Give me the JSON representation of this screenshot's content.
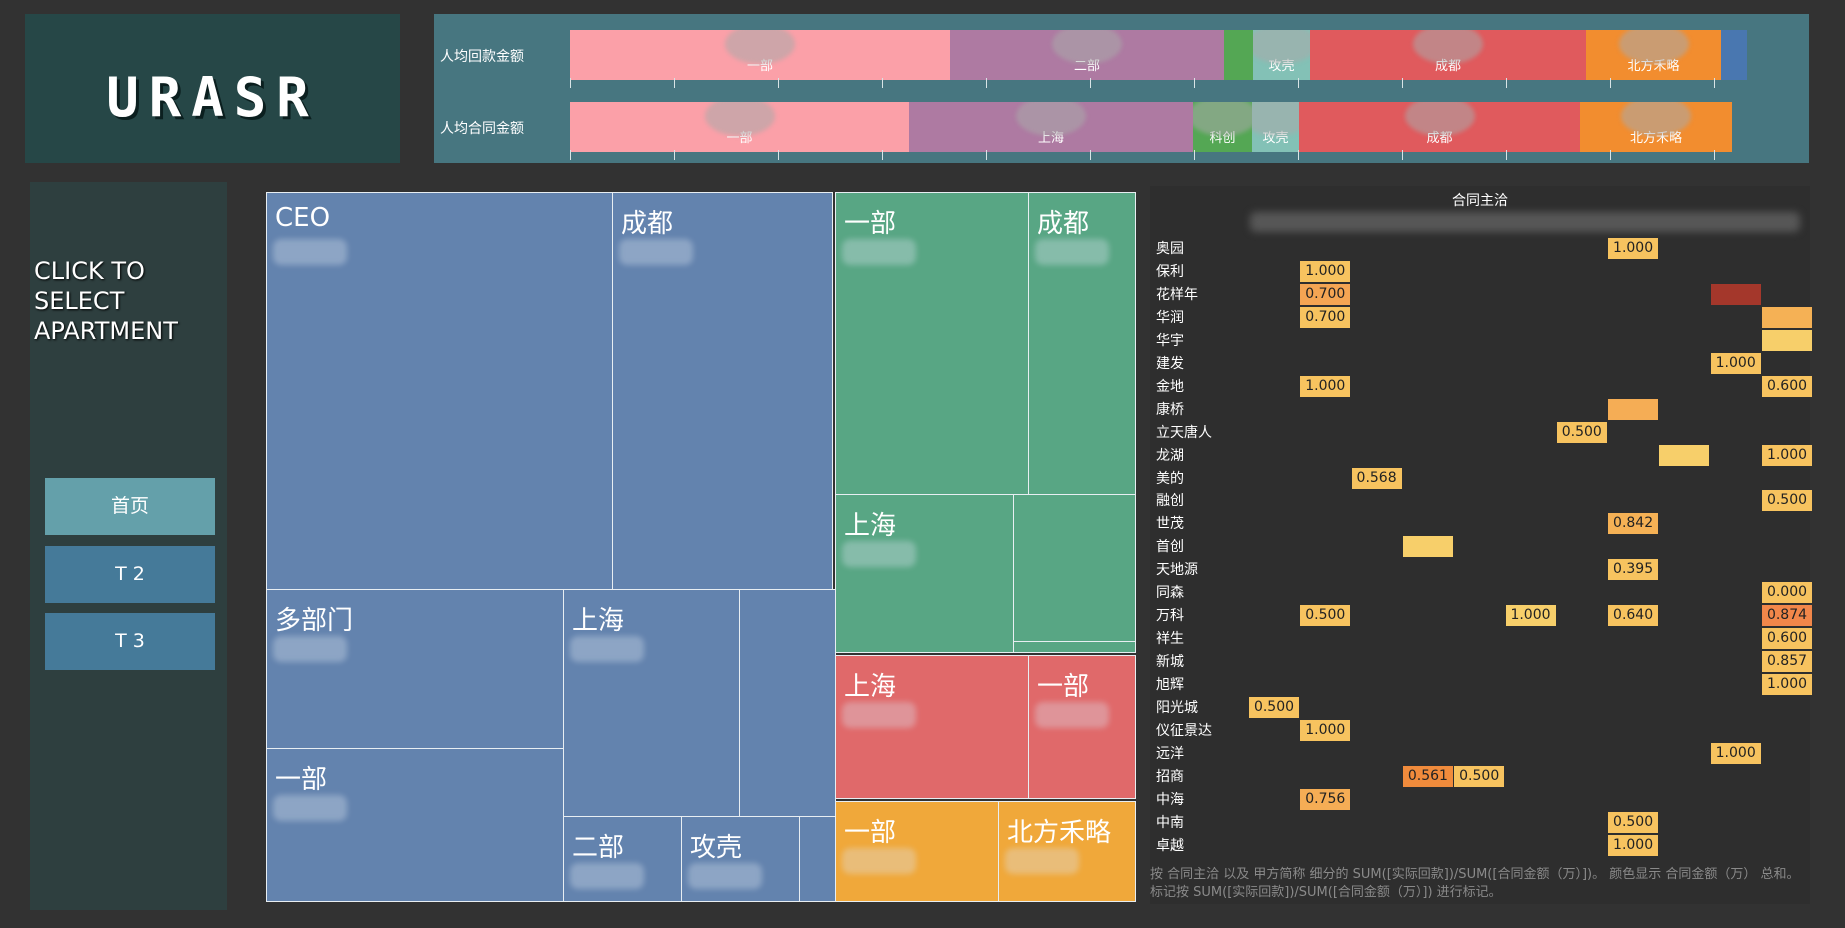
{
  "logo": {
    "text": "URASR"
  },
  "top_bars": [
    {
      "label": "人均回款金额",
      "segments": [
        {
          "label": "一部",
          "share": 0.323,
          "color": "#fba0a8"
        },
        {
          "label": "二部",
          "share": 0.233,
          "color": "#ae7aa2"
        },
        {
          "label": "",
          "share": 0.025,
          "color": "#54a754"
        },
        {
          "label": "攻壳",
          "share": 0.048,
          "color": "#83c1b6"
        },
        {
          "label": "成都",
          "share": 0.234,
          "color": "#e05a5d"
        },
        {
          "label": "北方禾略",
          "share": 0.115,
          "color": "#f28d2f"
        },
        {
          "label": "",
          "share": 0.022,
          "color": "#4977b0"
        }
      ]
    },
    {
      "label": "人均合同金额",
      "segments": [
        {
          "label": "一部",
          "share": 0.29,
          "color": "#fba0a8"
        },
        {
          "label": "上海",
          "share": 0.243,
          "color": "#ae7aa2"
        },
        {
          "label": "科创",
          "share": 0.05,
          "color": "#54a754"
        },
        {
          "label": "攻壳",
          "share": 0.04,
          "color": "#83c1b6"
        },
        {
          "label": "成都",
          "share": 0.24,
          "color": "#e05a5d"
        },
        {
          "label": "北方禾略",
          "share": 0.13,
          "color": "#f28d2f"
        }
      ]
    }
  ],
  "nav": {
    "title": "CLICK TO SELECT APARTMENT",
    "buttons": [
      "首页",
      "T 2",
      "T 3"
    ]
  },
  "treemap": [
    {
      "label": "CEO",
      "color": "blue"
    },
    {
      "label": "成都",
      "color": "blue"
    },
    {
      "label": "多部门",
      "color": "blue"
    },
    {
      "label": "上海",
      "color": "blue"
    },
    {
      "label": "",
      "color": "blue"
    },
    {
      "label": "一部",
      "color": "blue"
    },
    {
      "label": "二部",
      "color": "blue"
    },
    {
      "label": "攻壳",
      "color": "blue"
    },
    {
      "label": "",
      "color": "blue"
    },
    {
      "label": "一部",
      "color": "green"
    },
    {
      "label": "成都",
      "color": "green"
    },
    {
      "label": "上海",
      "color": "green"
    },
    {
      "label": "",
      "color": "green"
    },
    {
      "label": "",
      "color": "green"
    },
    {
      "label": "上海",
      "color": "red"
    },
    {
      "label": "一部",
      "color": "red"
    },
    {
      "label": "一部",
      "color": "orange"
    },
    {
      "label": "北方禾略",
      "color": "orange"
    }
  ],
  "heatmap": {
    "title": "合同主洽",
    "rows": [
      "奥园",
      "保利",
      "花样年",
      "华润",
      "华宇",
      "建发",
      "金地",
      "康桥",
      "立天唐人",
      "龙湖",
      "美的",
      "融创",
      "世茂",
      "首创",
      "天地源",
      "同森",
      "万科",
      "祥生",
      "新城",
      "旭辉",
      "阳光城",
      "仪征景达",
      "远洋",
      "招商",
      "中海",
      "中南",
      "卓越"
    ],
    "cells": [
      {
        "row": 0,
        "col": 7,
        "text": "1.000",
        "color": "#f7c35f"
      },
      {
        "row": 1,
        "col": 1,
        "text": "1.000",
        "color": "#f7c35f"
      },
      {
        "row": 2,
        "col": 1,
        "text": "0.700",
        "color": "#f4a553"
      },
      {
        "row": 2,
        "col": 9,
        "text": "",
        "color": "#a4372b"
      },
      {
        "row": 3,
        "col": 1,
        "text": "0.700",
        "color": "#f7c35f"
      },
      {
        "row": 3,
        "col": 10,
        "text": "",
        "color": "#f5b155"
      },
      {
        "row": 4,
        "col": 10,
        "text": "",
        "color": "#f7cf6a"
      },
      {
        "row": 5,
        "col": 9,
        "text": "1.000",
        "color": "#f7c35f"
      },
      {
        "row": 6,
        "col": 1,
        "text": "1.000",
        "color": "#f7c35f"
      },
      {
        "row": 6,
        "col": 10,
        "text": "0.600",
        "color": "#f7c35f"
      },
      {
        "row": 7,
        "col": 7,
        "text": "",
        "color": "#f5ad55"
      },
      {
        "row": 8,
        "col": 6,
        "text": "0.500",
        "color": "#f7c35f"
      },
      {
        "row": 9,
        "col": 8,
        "text": "",
        "color": "#f7cf6a"
      },
      {
        "row": 9,
        "col": 10,
        "text": "1.000",
        "color": "#f7c35f"
      },
      {
        "row": 10,
        "col": 2,
        "text": "0.568",
        "color": "#f7c35f"
      },
      {
        "row": 11,
        "col": 10,
        "text": "0.500",
        "color": "#f7c35f"
      },
      {
        "row": 12,
        "col": 7,
        "text": "0.842",
        "color": "#f5b155"
      },
      {
        "row": 13,
        "col": 3,
        "text": "",
        "color": "#f7cf6a"
      },
      {
        "row": 14,
        "col": 7,
        "text": "0.395",
        "color": "#f7c35f"
      },
      {
        "row": 15,
        "col": 10,
        "text": "0.000",
        "color": "#f7c35f"
      },
      {
        "row": 16,
        "col": 1,
        "text": "0.500",
        "color": "#f7c35f"
      },
      {
        "row": 16,
        "col": 5,
        "text": "1.000",
        "color": "#f7cf6a"
      },
      {
        "row": 16,
        "col": 7,
        "text": "0.640",
        "color": "#f7c35f"
      },
      {
        "row": 16,
        "col": 10,
        "text": "0.874",
        "color": "#f2874a"
      },
      {
        "row": 17,
        "col": 10,
        "text": "0.600",
        "color": "#f7c35f"
      },
      {
        "row": 18,
        "col": 10,
        "text": "0.857",
        "color": "#f7c35f"
      },
      {
        "row": 19,
        "col": 10,
        "text": "1.000",
        "color": "#f7c35f"
      },
      {
        "row": 20,
        "col": 0,
        "text": "0.500",
        "color": "#f7c35f"
      },
      {
        "row": 21,
        "col": 1,
        "text": "1.000",
        "color": "#f7c35f"
      },
      {
        "row": 22,
        "col": 9,
        "text": "1.000",
        "color": "#f7c35f"
      },
      {
        "row": 23,
        "col": 3,
        "text": "0.561",
        "color": "#f08b3c"
      },
      {
        "row": 23,
        "col": 4,
        "text": "0.500",
        "color": "#f7c35f"
      },
      {
        "row": 24,
        "col": 1,
        "text": "0.756",
        "color": "#f5ad55"
      },
      {
        "row": 25,
        "col": 7,
        "text": "0.500",
        "color": "#f7c35f"
      },
      {
        "row": 26,
        "col": 7,
        "text": "1.000",
        "color": "#f7c35f"
      }
    ],
    "caption": "按 合同主洽 以及 甲方简称 细分的 SUM([实际回款])/SUM([合同金额（万）])。 颜色显示 合同金额（万） 总和。 标记按 SUM([实际回款])/SUM([合同金额（万）]) 进行标记。"
  }
}
